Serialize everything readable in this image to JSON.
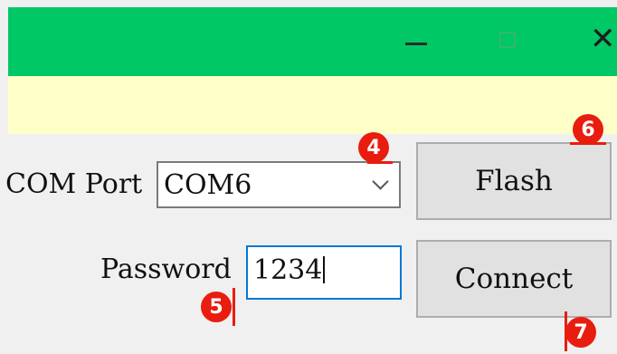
{
  "window": {
    "controls": {
      "minimize_icon": "minimize-icon",
      "maximize_icon": "maximize-icon",
      "close_icon": "close-icon",
      "close_glyph": "✕"
    },
    "colors": {
      "titlebar": "#00c865",
      "banner": "#ffffc8",
      "panel": "#f0f0f0",
      "badge": "#e81d0f",
      "focus_border": "#0078d7"
    }
  },
  "form": {
    "com_port_label": "COM Port",
    "com_port_value": "COM6",
    "password_label": "Password",
    "password_value": "1234"
  },
  "buttons": {
    "flash": "Flash",
    "connect": "Connect"
  },
  "badges": {
    "com_port": "4",
    "password": "5",
    "flash": "6",
    "connect": "7"
  }
}
